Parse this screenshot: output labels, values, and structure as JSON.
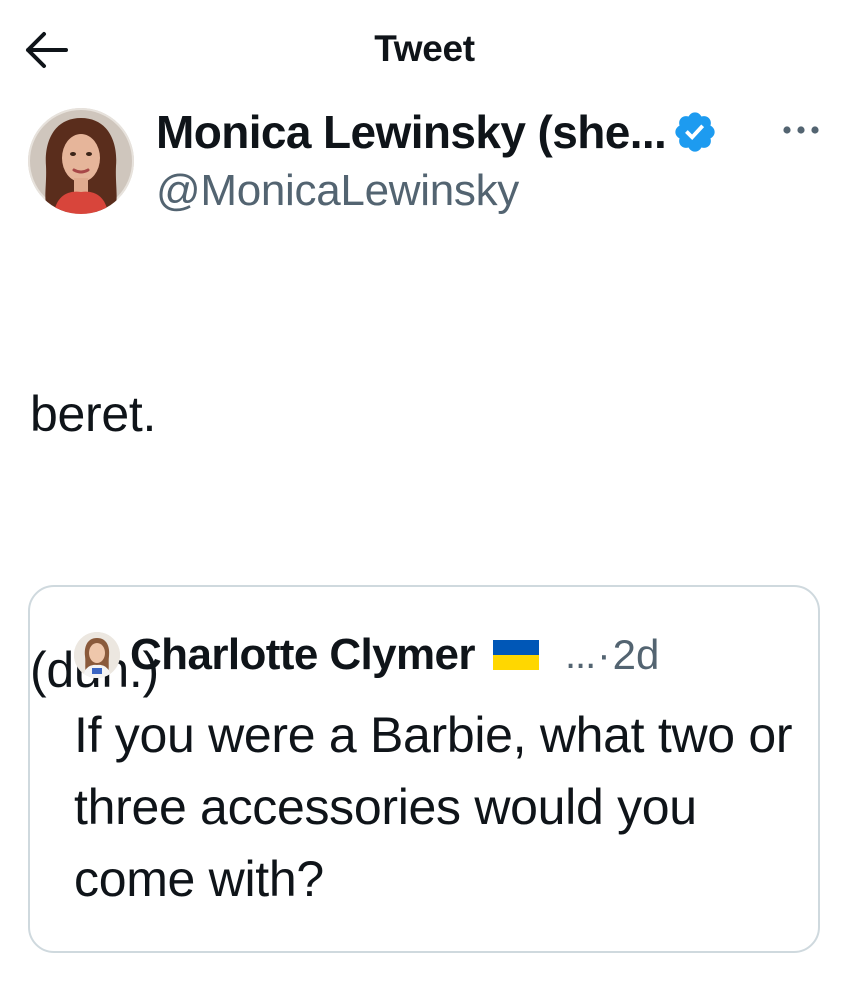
{
  "header": {
    "title": "Tweet",
    "back_icon": "arrow-left-icon"
  },
  "author": {
    "display_name": "Monica Lewinsky (she...",
    "handle": "@MonicaLewinsky",
    "verified": true,
    "verified_color": "#1d9bf0",
    "avatar_icon": "avatar-photo",
    "more_icon": "more-horizontal-icon"
  },
  "tweet": {
    "lines": [
      "beret.",
      "",
      "(duh.)"
    ]
  },
  "quoted_tweet": {
    "display_name": "Charlotte Clymer",
    "flag_icon": "ukraine-flag-icon",
    "truncation": "...",
    "separator": "·",
    "time": "2d",
    "text": "If you were a Barbie, what two or three accessories would you come with?"
  },
  "colors": {
    "text_primary": "#0f1419",
    "text_secondary": "#536471",
    "border": "#cfd9de",
    "verified_blue": "#1d9bf0",
    "flag_blue": "#0057b7",
    "flag_yellow": "#ffd700"
  }
}
